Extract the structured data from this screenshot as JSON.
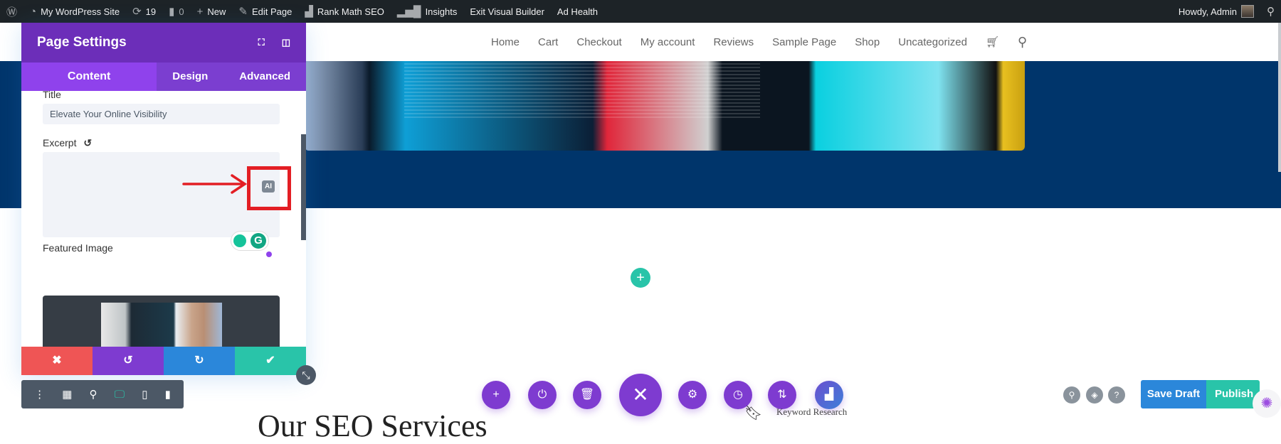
{
  "adminbar": {
    "site": "My WordPress Site",
    "updates": "19",
    "comments": "0",
    "new": "New",
    "edit": "Edit Page",
    "rankmath": "Rank Math SEO",
    "insights": "Insights",
    "exit": "Exit Visual Builder",
    "adhealth": "Ad Health",
    "howdy": "Howdy, Admin"
  },
  "nav": [
    "Home",
    "Cart",
    "Checkout",
    "My account",
    "Reviews",
    "Sample Page",
    "Shop",
    "Uncategorized"
  ],
  "panel": {
    "title": "Page Settings",
    "tabs": [
      "Content",
      "Design",
      "Advanced"
    ],
    "title_label": "Title",
    "title_value": "Elevate Your Online Visibility",
    "excerpt_label": "Excerpt",
    "excerpt_value": "",
    "ai_badge": "AI",
    "featured_label": "Featured Image"
  },
  "page": {
    "heading": "Our SEO Services",
    "keyword": "Keyword Research"
  },
  "buttons": {
    "save_draft": "Save Draft",
    "publish": "Publish"
  },
  "colors": {
    "purple": "#7e3bd0",
    "cancel": "#ef5555",
    "undo": "#7e3bd0",
    "redo": "#2b87da",
    "save": "#29c4a9",
    "hero": "#00356b",
    "highlight": "#e31e24"
  }
}
